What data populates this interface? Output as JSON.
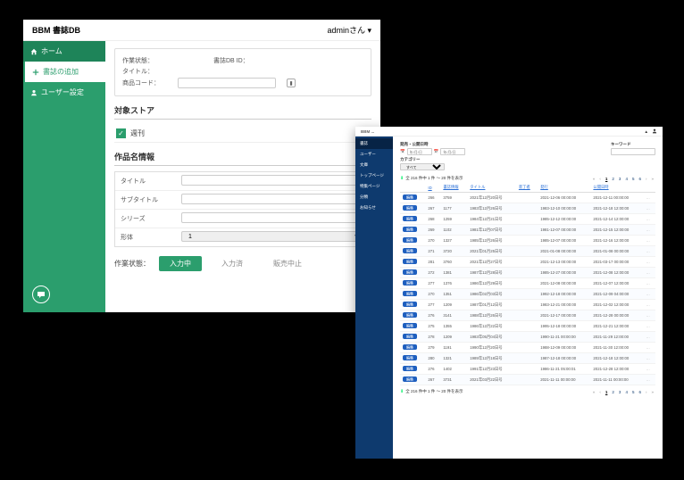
{
  "win1": {
    "app_title": "BBM 書誌DB",
    "user_label": "adminさん ▾",
    "sidebar": {
      "home": "ホーム",
      "add": "書誌の追加",
      "user": "ユーザー設定"
    },
    "panel": {
      "status_label": "作業状態：",
      "dbid_label": "書誌DB ID：",
      "title_label": "タイトル：",
      "code_label": "商品コード："
    },
    "store_section": "対象ストア",
    "store_option": "週刊",
    "name_section": "作品名情報",
    "fields": {
      "main_title": "タイトル",
      "subtitle": "サブタイトル",
      "series": "シリーズ",
      "format": "形体"
    },
    "format_default": "1",
    "status_bar": {
      "label": "作業状態：",
      "btn_input": "入力中",
      "btn_done": "入力済",
      "btn_stop": "販売中止"
    }
  },
  "win2": {
    "brand": "BBM ...",
    "sidebar": [
      "書誌",
      "ユーザー",
      "文庫",
      "トップページ",
      "特集ページ",
      "分類",
      "お知らせ"
    ],
    "filters": {
      "date_label": "発売・公開日時",
      "date_icon": "📅",
      "date_from": "年/月/日",
      "date_to": "年/月/日",
      "keyword_label": "キーワード",
      "category_label": "カテゴリー",
      "category_default": "すべて"
    },
    "pager": {
      "total_text": "全 216 件中 1 件 〜 20 件を表示",
      "pages": [
        "«",
        "‹",
        "1",
        "2",
        "3",
        "4",
        "5",
        "6",
        "›",
        "»"
      ]
    },
    "columns": [
      "",
      "ID",
      "書誌情報",
      "タイトル",
      "装丁者",
      "発行",
      "公開日時",
      ""
    ],
    "edit_label": "編集",
    "rows": [
      {
        "id": "266",
        "code": "3759",
        "title": "2021年12月20日号",
        "author": "",
        "pub": "2021-12-06 00:00:00",
        "rel": "2021-12-11 00:00:00"
      },
      {
        "id": "267",
        "code": "1177",
        "title": "1983年12月26日号",
        "author": "",
        "pub": "1983-12-10 00:00:00",
        "rel": "2021-12-18 12:00:00"
      },
      {
        "id": "268",
        "code": "1259",
        "title": "1984年12月21日号",
        "author": "",
        "pub": "1985-12-12 00:00:00",
        "rel": "2021-12-14 12:00:00"
      },
      {
        "id": "269",
        "code": "1102",
        "title": "1981年12月07日号",
        "author": "",
        "pub": "1981-12-07 00:00:00",
        "rel": "2021-12-15 12:00:00"
      },
      {
        "id": "270",
        "code": "1327",
        "title": "1985年12月26日号",
        "author": "",
        "pub": "1985-12-07 00:00:00",
        "rel": "2021-12-16 12:00:00"
      },
      {
        "id": "271",
        "code": "3720",
        "title": "2021年01月25日号",
        "author": "",
        "pub": "2021-01-08 00:00:00",
        "rel": "2021-01-08 00:00:00"
      },
      {
        "id": "281",
        "code": "3760",
        "title": "2021年12月27日号",
        "author": "",
        "pub": "2021-12-13 00:00:00",
        "rel": "2021-03-17 00:00:00"
      },
      {
        "id": "272",
        "code": "1381",
        "title": "1987年12月28日号",
        "author": "",
        "pub": "1985-12-27 00:00:00",
        "rel": "2021-12-08 12:00:00"
      },
      {
        "id": "277",
        "code": "1376",
        "title": "1986年12月29日号",
        "author": "",
        "pub": "2021-12-08 00:00:00",
        "rel": "2021-12-07 12:00:00"
      },
      {
        "id": "270",
        "code": "1351",
        "title": "1986年02月03日号",
        "author": "",
        "pub": "1992-12-18 00:00:00",
        "rel": "2021-12-09 04:00:00"
      },
      {
        "id": "277",
        "code": "1209",
        "title": "1987年01月12日号",
        "author": "",
        "pub": "1983-12-21 00:00:00",
        "rel": "2021-12-02 12:00:00"
      },
      {
        "id": "276",
        "code": "3141",
        "title": "1988年12月26日号",
        "author": "",
        "pub": "2021-12-17 00:00:00",
        "rel": "2021-12-28 00:00:00"
      },
      {
        "id": "275",
        "code": "1355",
        "title": "1986年12月22日号",
        "author": "",
        "pub": "1995-12-18 00:00:00",
        "rel": "2021-12-21 12:00:00"
      },
      {
        "id": "278",
        "code": "1209",
        "title": "1983年05月04日号",
        "author": "",
        "pub": "1990-11-21 00:00:00",
        "rel": "2021-11-29 12:00:00"
      },
      {
        "id": "279",
        "code": "1191",
        "title": "1990年12月20日号",
        "author": "",
        "pub": "1988-12-09 00:00:00",
        "rel": "2021-11-30 12:00:00"
      },
      {
        "id": "280",
        "code": "1321",
        "title": "1989年12月18日号",
        "author": "",
        "pub": "1987-12-18 00:00:00",
        "rel": "2021-12-18 12:00:00"
      },
      {
        "id": "276",
        "code": "1402",
        "title": "1991年12月23日号",
        "author": "",
        "pub": "1986-11-21 05:00:01",
        "rel": "2021-12-28 12:00:00"
      },
      {
        "id": "267",
        "code": "3731",
        "title": "2021年03月22日号",
        "author": "",
        "pub": "2021-11-11 00:00:00",
        "rel": "2021-11-11 00:00:00"
      }
    ]
  }
}
